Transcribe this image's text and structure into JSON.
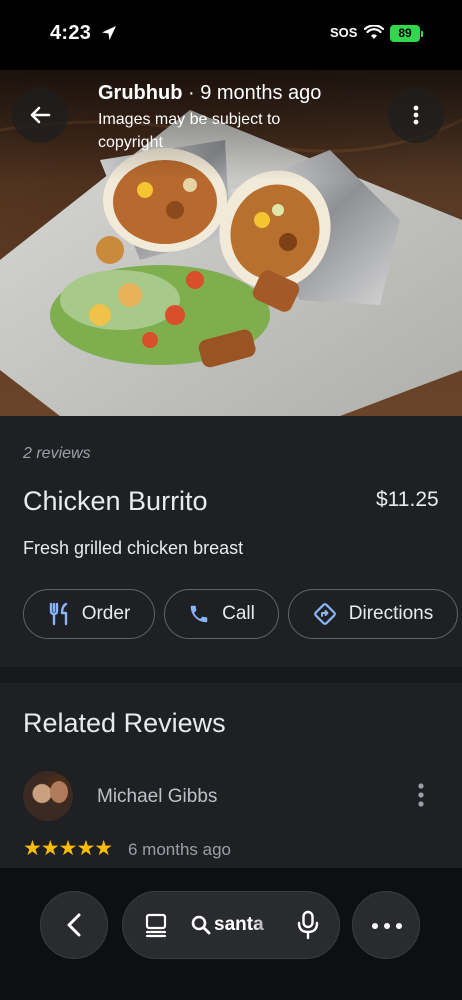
{
  "status_bar": {
    "time": "4:23",
    "sos": "SOS",
    "battery": "89"
  },
  "photo": {
    "source_name": "Grubhub",
    "source_age": "9 months ago",
    "copyright_note": "Images may be subject to copyright"
  },
  "dish": {
    "reviews_count": "2 reviews",
    "name": "Chicken Burrito",
    "price": "$11.25",
    "description": "Fresh grilled chicken breast"
  },
  "actions": {
    "order_label": "Order",
    "call_label": "Call",
    "directions_label": "Directions"
  },
  "related": {
    "title": "Related Reviews",
    "reviewer_name": "Michael Gibbs",
    "stars": "★★★★★",
    "review_age": "6 months ago"
  },
  "browser": {
    "url_text": "santa"
  },
  "colors": {
    "accent_blue": "#8ab4f8",
    "star_yellow": "#fbbc04",
    "background": "#1f2023"
  }
}
